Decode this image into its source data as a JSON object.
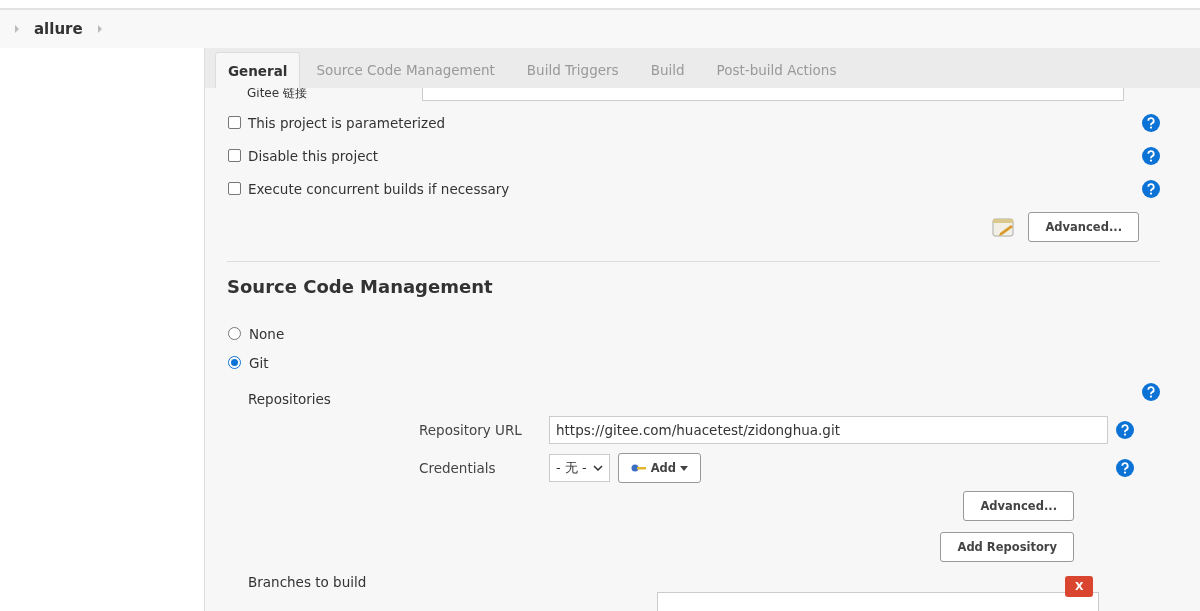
{
  "breadcrumb": {
    "project": "allure"
  },
  "tabs": [
    {
      "label": "General",
      "selected": true
    },
    {
      "label": "Source Code Management",
      "selected": false
    },
    {
      "label": "Build Triggers",
      "selected": false
    },
    {
      "label": "Build",
      "selected": false
    },
    {
      "label": "Post-build Actions",
      "selected": false
    }
  ],
  "general": {
    "gitee_label": "Gitee 链接",
    "options": [
      {
        "label": "This project is parameterized",
        "checked": false
      },
      {
        "label": "Disable this project",
        "checked": false
      },
      {
        "label": "Execute concurrent builds if necessary",
        "checked": false
      }
    ],
    "advanced_button": "Advanced..."
  },
  "scm": {
    "title": "Source Code Management",
    "options": [
      {
        "label": "None",
        "selected": false
      },
      {
        "label": "Git",
        "selected": true
      }
    ],
    "repositories_label": "Repositories",
    "repository_url_label": "Repository URL",
    "repository_url": "https://gitee.com/huacetest/zidonghua.git",
    "credentials_label": "Credentials",
    "credentials_value": "- 无 -",
    "add_button": "Add",
    "advanced_button": "Advanced...",
    "add_repository_button": "Add Repository",
    "branches_label": "Branches to build",
    "delete_button": "X"
  }
}
